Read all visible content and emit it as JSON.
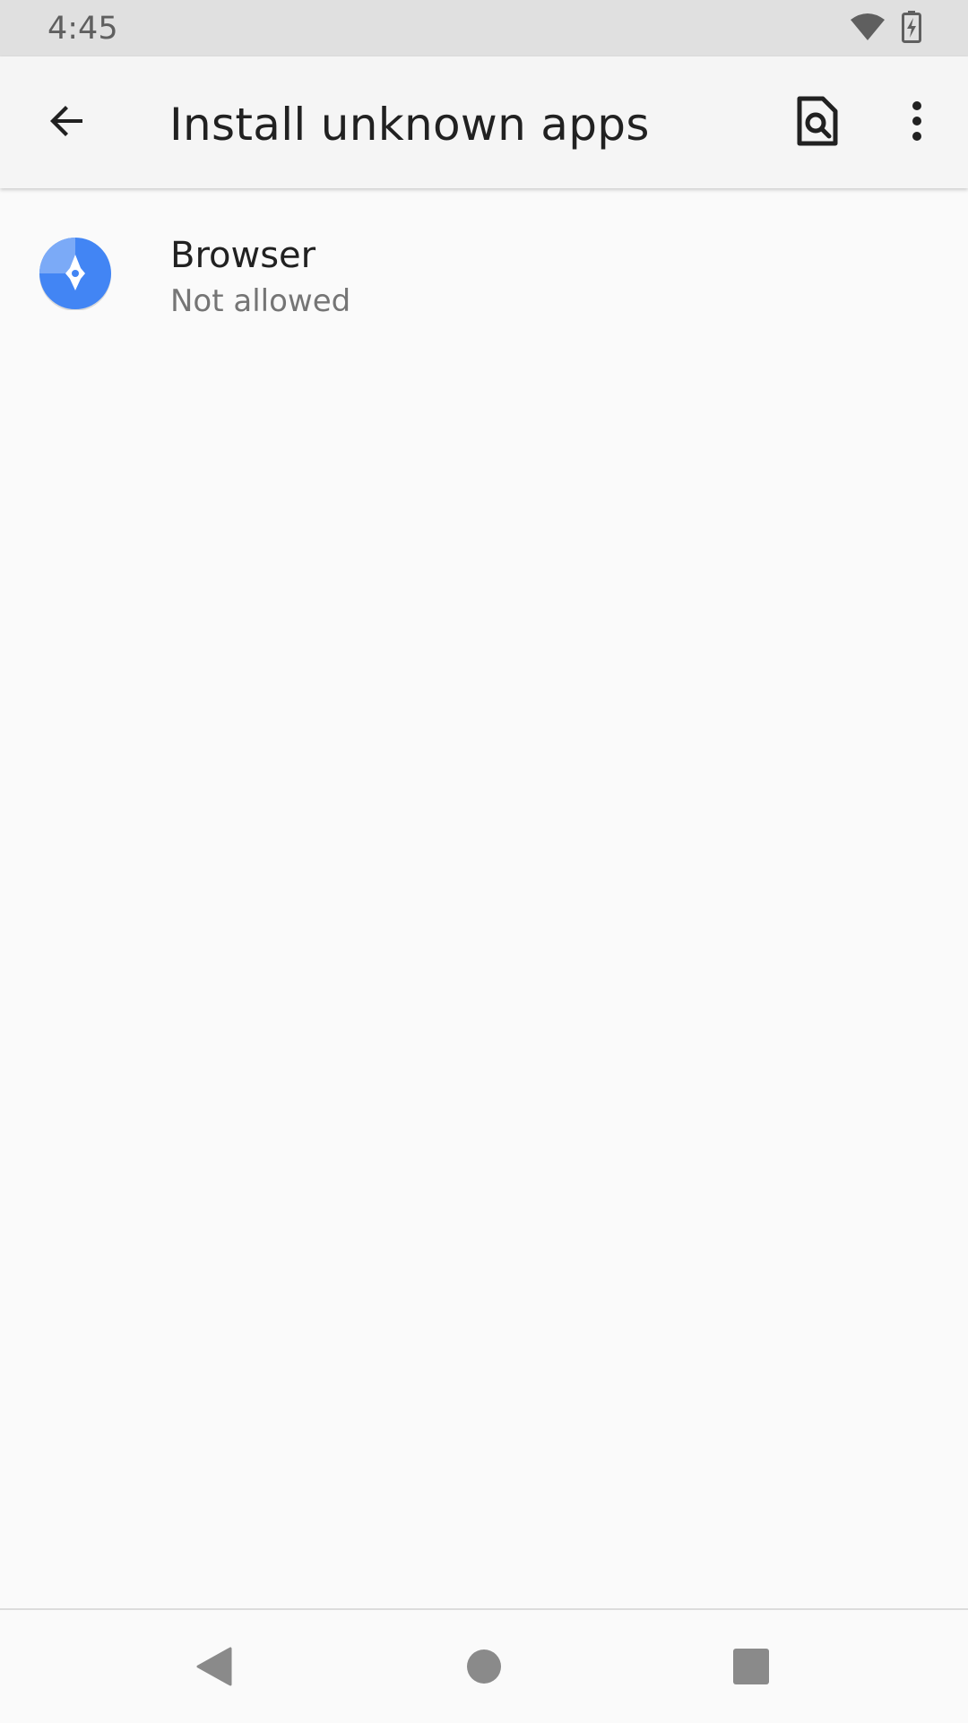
{
  "status_bar": {
    "time": "4:45",
    "icons": [
      "wifi-icon",
      "battery-charging-icon"
    ]
  },
  "app_bar": {
    "title": "Install unknown apps",
    "back_icon": "arrow-back-icon",
    "search_icon": "search-document-icon",
    "more_icon": "more-vert-icon"
  },
  "apps": [
    {
      "name": "Browser",
      "status": "Not allowed",
      "icon": "browser-app-icon"
    }
  ],
  "nav_bar": {
    "icons": [
      "nav-back-icon",
      "nav-home-icon",
      "nav-recents-icon"
    ]
  },
  "colors": {
    "status_bar_bg": "#e0e0e0",
    "app_bar_bg": "#f5f5f5",
    "background": "#fafafa",
    "primary_text": "#212121",
    "secondary_text": "#757575",
    "browser_blue": "#4285f4"
  }
}
